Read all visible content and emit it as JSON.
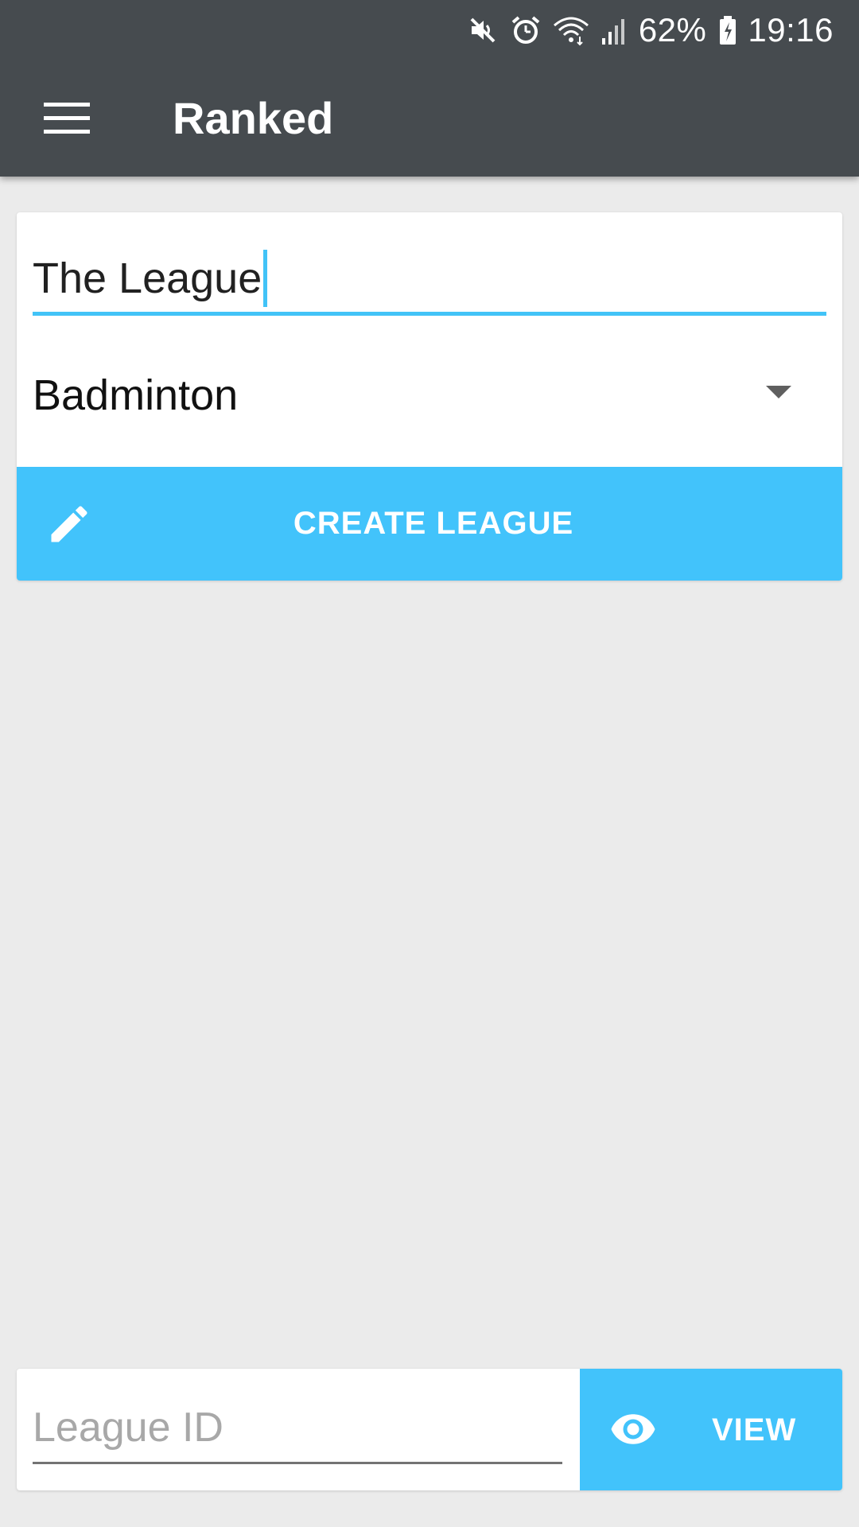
{
  "status_bar": {
    "icons": [
      "mute-icon",
      "alarm-icon",
      "wifi-icon",
      "signal-icon",
      "battery-icon"
    ],
    "battery_percent": "62%",
    "time": "19:16"
  },
  "toolbar": {
    "menu_icon": "hamburger-menu-icon",
    "title": "Ranked"
  },
  "create_form": {
    "league_name_value": "The League",
    "sport_selected": "Badminton",
    "create_button_icon": "pencil-icon",
    "create_button_label": "CREATE LEAGUE"
  },
  "view_form": {
    "league_id_placeholder": "League ID",
    "league_id_value": "",
    "view_button_icon": "eye-icon",
    "view_button_label": "VIEW"
  },
  "colors": {
    "app_bar": "#464b4f",
    "accent": "#42c3fb",
    "background": "#ebebeb",
    "card": "#ffffff"
  }
}
